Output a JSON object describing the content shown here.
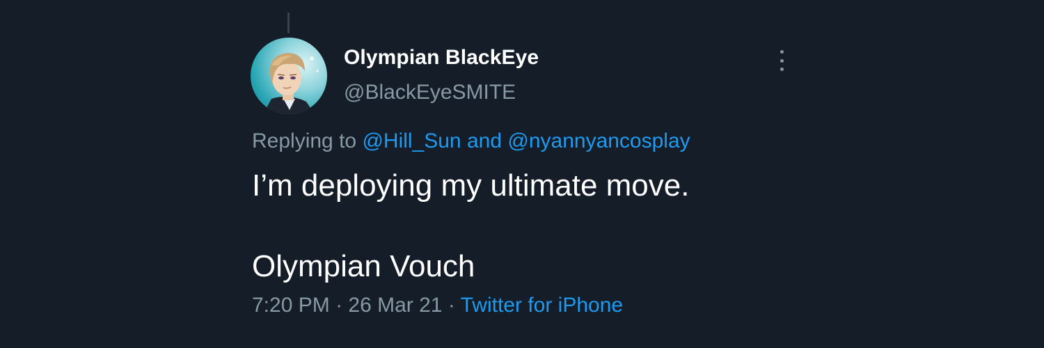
{
  "tweet": {
    "author": {
      "display_name": "Olympian BlackEye",
      "handle": "@BlackEyeSMITE"
    },
    "replying": {
      "prefix": "Replying to",
      "user1": "@Hill_Sun",
      "conjunction": "and",
      "user2": "@nyannyancosplay"
    },
    "text_lines": [
      "I’m deploying my ultimate move.",
      "Olympian Vouch"
    ],
    "meta": {
      "time": "7:20 PM",
      "separator": "·",
      "date": "26 Mar 21",
      "source": "Twitter for iPhone"
    },
    "more_icon": "more-vertical-icon"
  },
  "colors": {
    "background": "#151d28",
    "primary_text": "#ffffff",
    "secondary_text": "#8899a6",
    "link": "#1d9bf0"
  }
}
